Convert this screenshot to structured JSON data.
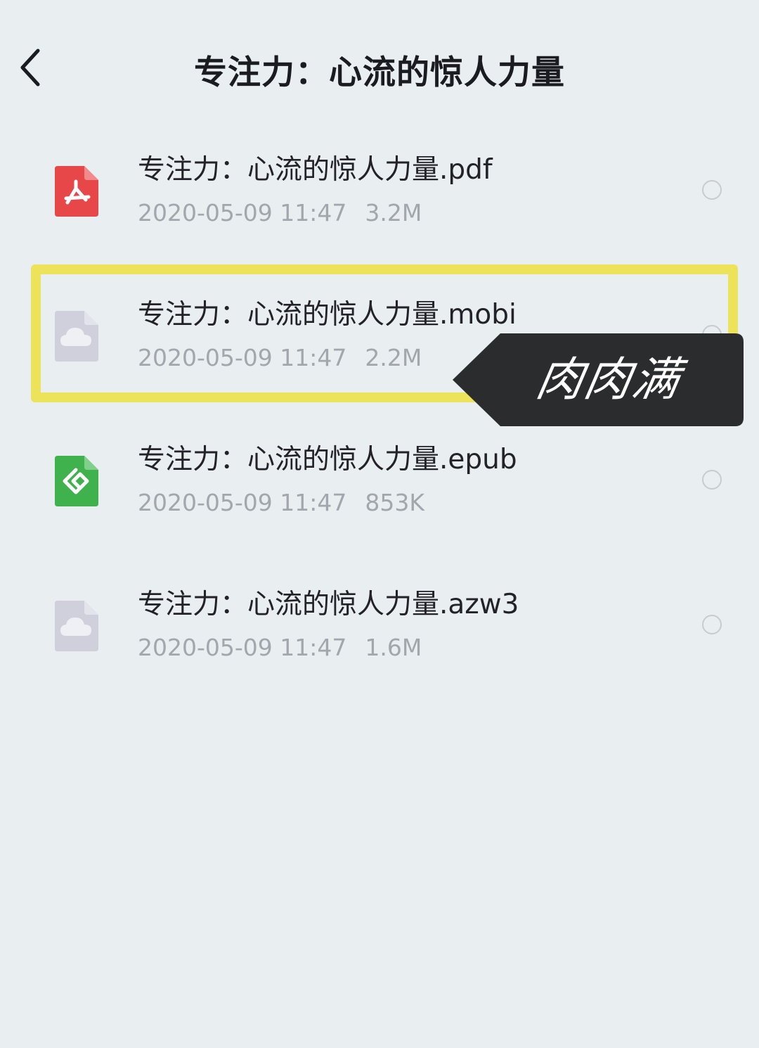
{
  "header": {
    "back_icon": "chevron-left-icon",
    "title": "专注力：心流的惊人力量"
  },
  "files": [
    {
      "name": "专注力：心流的惊人力量.pdf",
      "date": "2020-05-09 11:47",
      "size": "3.2M",
      "icon": "pdf-icon",
      "icon_color": "#e8474a",
      "selected": false
    },
    {
      "name": "专注力：心流的惊人力量.mobi",
      "date": "2020-05-09 11:47",
      "size": "2.2M",
      "icon": "cloud-file-icon",
      "icon_color": "#cfd0dc",
      "selected": false
    },
    {
      "name": "专注力：心流的惊人力量.epub",
      "date": "2020-05-09 11:47",
      "size": "853K",
      "icon": "epub-icon",
      "icon_color": "#3fb24d",
      "selected": false
    },
    {
      "name": "专注力：心流的惊人力量.azw3",
      "date": "2020-05-09 11:47",
      "size": "1.6M",
      "icon": "cloud-file-icon",
      "icon_color": "#cfd0dc",
      "selected": false
    }
  ],
  "annotation": {
    "watermark_text": "肉肉满",
    "highlight_color": "#ede35a",
    "tag_color": "#2b2c2e"
  }
}
